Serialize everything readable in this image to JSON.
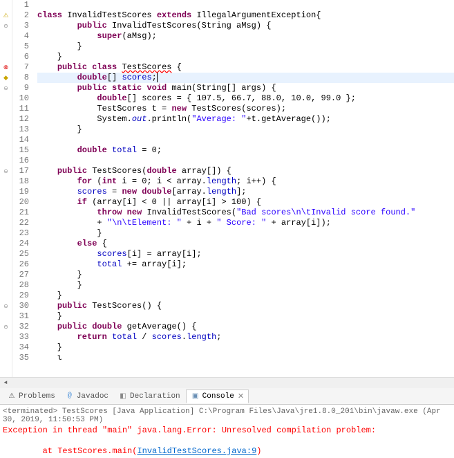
{
  "lines": [
    {
      "n": 1,
      "gutter": "",
      "html": ""
    },
    {
      "n": 2,
      "gutter": "warn",
      "html": "<span class='kw'>class</span> InvalidTestScores <span class='kw'>extends</span> IllegalArgumentException{"
    },
    {
      "n": 3,
      "gutter": "fold",
      "html": "        <span class='kw'>public</span> InvalidTestScores(String aMsg) {"
    },
    {
      "n": 4,
      "gutter": "",
      "html": "            <span class='kw'>super</span>(aMsg);"
    },
    {
      "n": 5,
      "gutter": "",
      "html": "        }"
    },
    {
      "n": 6,
      "gutter": "",
      "html": "    }"
    },
    {
      "n": 7,
      "gutter": "err",
      "html": "    <span class='kw'>public</span> <span class='kw'>class</span> <u style='text-decoration:wavy underline red'>TestScores</u> {"
    },
    {
      "n": 8,
      "gutter": "warn2",
      "hl": true,
      "html": "        <span class='kw'>double</span>[] <span class='fld'>scores</span>;<span style='border-left:1px solid #000'></span>"
    },
    {
      "n": 9,
      "gutter": "fold",
      "html": "        <span class='kw'>public</span> <span class='kw'>static</span> <span class='kw'>void</span> main(String[] args) {"
    },
    {
      "n": 10,
      "gutter": "",
      "html": "            <span class='kw'>double</span>[] scores = { 107.5, 66.7, 88.0, 10.0, 99.0 };"
    },
    {
      "n": 11,
      "gutter": "",
      "html": "            TestScores t = <span class='kw'>new</span> TestScores(scores);"
    },
    {
      "n": 12,
      "gutter": "",
      "html": "            System.<span class='sfld'>out</span>.println(<span class='str'>\"Average: \"</span>+t.getAverage());"
    },
    {
      "n": 13,
      "gutter": "",
      "html": "        }"
    },
    {
      "n": 14,
      "gutter": "",
      "html": ""
    },
    {
      "n": 15,
      "gutter": "",
      "html": "        <span class='kw'>double</span> <span class='fld'>total</span> = 0;"
    },
    {
      "n": 16,
      "gutter": "",
      "html": ""
    },
    {
      "n": 17,
      "gutter": "fold",
      "html": "    <span class='kw'>public</span> TestScores(<span class='kw'>double</span> array[]) {"
    },
    {
      "n": 18,
      "gutter": "",
      "html": "        <span class='kw'>for</span> (<span class='kw'>int</span> i = 0; i &lt; array.<span class='fld'>length</span>; i++) {"
    },
    {
      "n": 19,
      "gutter": "",
      "html": "        <span class='fld'>scores</span> = <span class='kw'>new</span> <span class='kw'>double</span>[array.<span class='fld'>length</span>];"
    },
    {
      "n": 20,
      "gutter": "",
      "html": "        <span class='kw'>if</span> (array[i] &lt; 0 || array[i] &gt; 100) {"
    },
    {
      "n": 21,
      "gutter": "",
      "html": "            <span class='kw'>throw</span> <span class='kw'>new</span> InvalidTestScores(<span class='str'>\"Bad scores\\n\\tInvalid score found.\"</span>"
    },
    {
      "n": 22,
      "gutter": "",
      "html": "            + <span class='str'>\"\\n\\tElement: \"</span> + i + <span class='str'>\" Score: \"</span> + array[i]);"
    },
    {
      "n": 23,
      "gutter": "",
      "html": "            }"
    },
    {
      "n": 24,
      "gutter": "",
      "html": "        <span class='kw'>else</span> {"
    },
    {
      "n": 25,
      "gutter": "",
      "html": "            <span class='fld'>scores</span>[i] = array[i];"
    },
    {
      "n": 26,
      "gutter": "",
      "html": "            <span class='fld'>total</span> += array[i];"
    },
    {
      "n": 27,
      "gutter": "",
      "html": "        }"
    },
    {
      "n": 28,
      "gutter": "",
      "html": "        }"
    },
    {
      "n": 29,
      "gutter": "",
      "html": "    }"
    },
    {
      "n": 30,
      "gutter": "fold",
      "html": "    <span class='kw'>public</span> TestScores() {"
    },
    {
      "n": 31,
      "gutter": "",
      "html": "    }"
    },
    {
      "n": 32,
      "gutter": "fold",
      "html": "    <span class='kw'>public</span> <span class='kw'>double</span> getAverage() {"
    },
    {
      "n": 33,
      "gutter": "",
      "html": "        <span class='kw'>return</span> <span class='fld'>total</span> / <span class='fld'>scores</span>.<span class='fld'>length</span>;"
    },
    {
      "n": 34,
      "gutter": "",
      "html": "    }"
    },
    {
      "n": 35,
      "gutter": "",
      "html": "    ι"
    }
  ],
  "tabs": {
    "problems": "Problems",
    "javadoc": "Javadoc",
    "declaration": "Declaration",
    "console": "Console"
  },
  "console": {
    "header": "<terminated> TestScores [Java Application] C:\\Program Files\\Java\\jre1.8.0_201\\bin\\javaw.exe (Apr 30, 2019, 11:50:53 PM)",
    "line1": "Exception in thread \"main\" java.lang.Error: Unresolved compilation problem: ",
    "line2_prefix": "        at TestScores.main(",
    "line2_link": "InvalidTestScores.java:9",
    "line2_suffix": ")"
  }
}
